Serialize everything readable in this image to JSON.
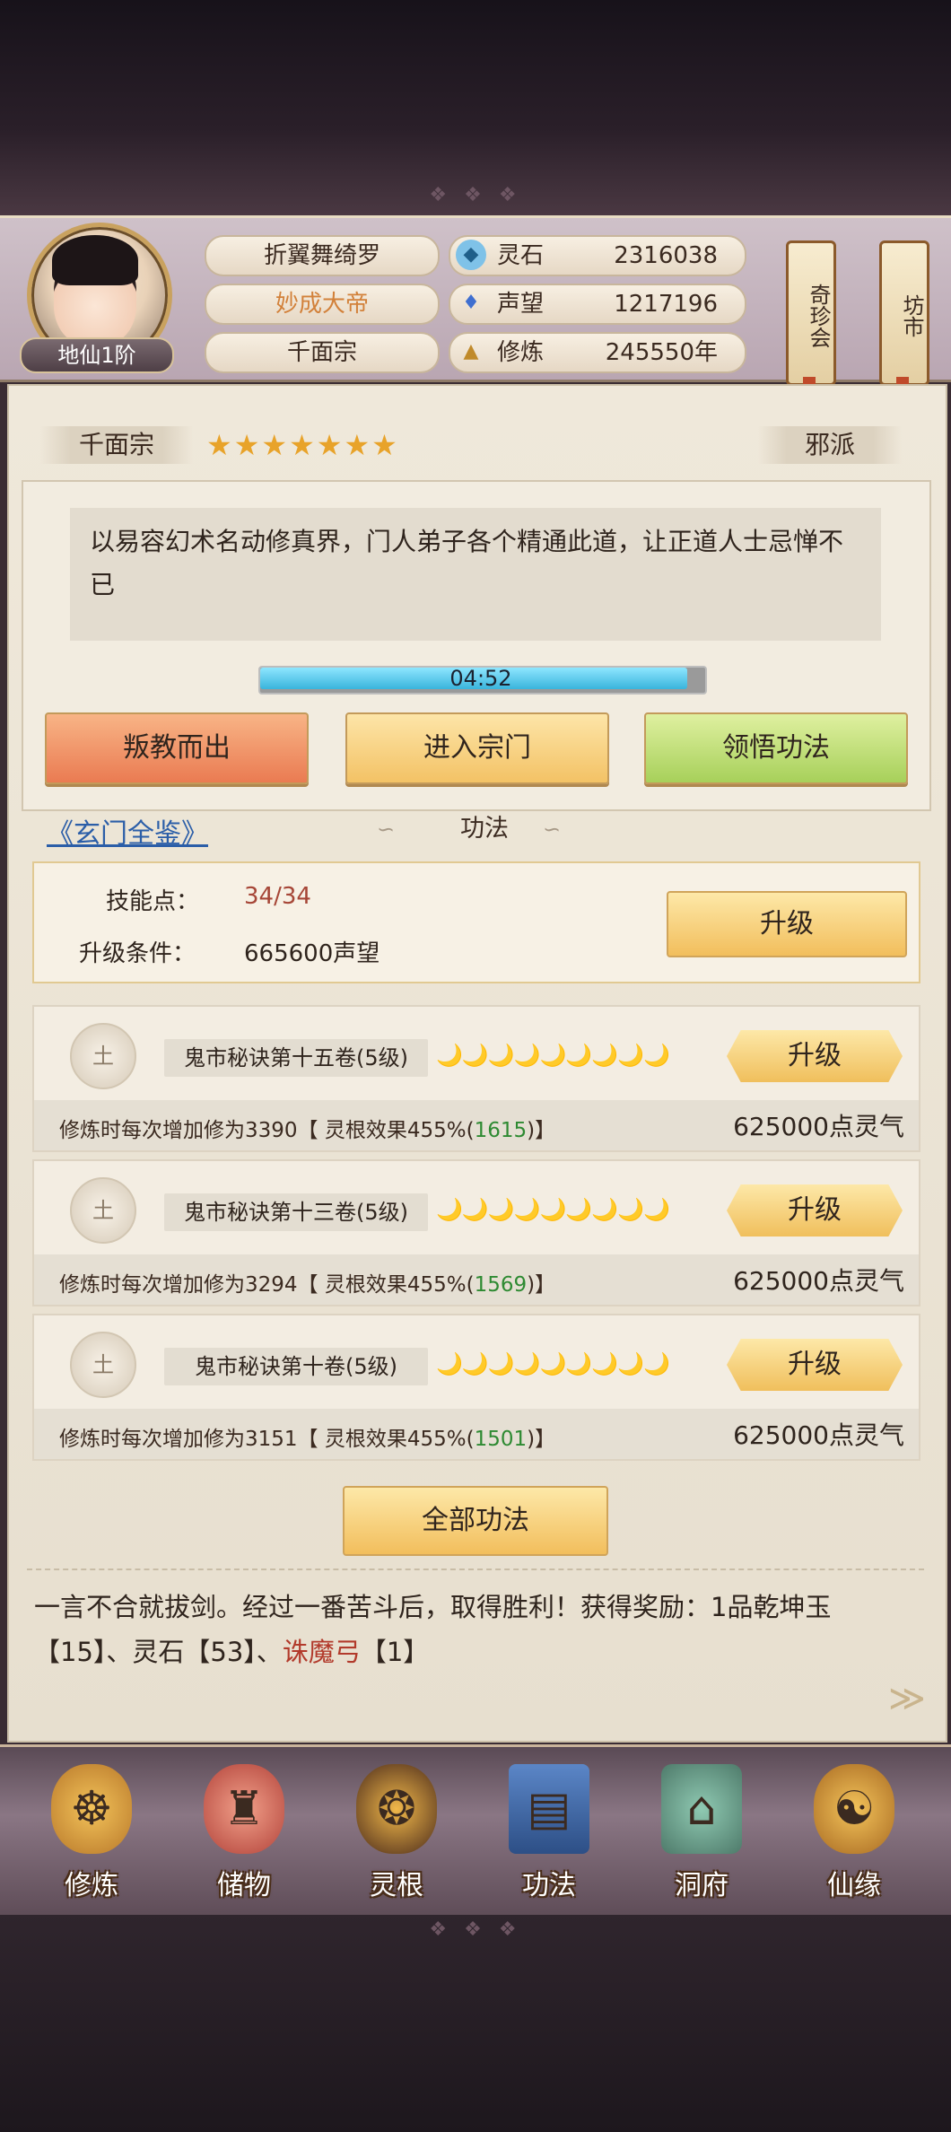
{
  "header": {
    "rank": "地仙1阶",
    "player_name": "折翼舞绮罗",
    "title": "妙成大帝",
    "sect": "千面宗",
    "stats": [
      {
        "icon": "spirit-stone-icon",
        "label": "灵石",
        "value": "2316038"
      },
      {
        "icon": "reputation-icon",
        "label": "声望",
        "value": "1217196"
      },
      {
        "icon": "meditation-icon",
        "label": "修炼",
        "value": "245550年"
      }
    ],
    "side_buttons": {
      "treasure": "奇珍会",
      "market": "坊市"
    }
  },
  "sect_panel": {
    "name": "千面宗",
    "stars": "★★★★★★★",
    "alignment": "邪派",
    "description": "以易容幻术名动修真界，门人弟子各个精通此道，让正道人士忌惮不已",
    "timer": "04:52",
    "timer_progress": 0.96,
    "buttons": {
      "defect": "叛教而出",
      "enter": "进入宗门",
      "learn": "领悟功法"
    }
  },
  "skills_section": {
    "book_link": "《玄门全鉴》",
    "title": "功法",
    "skill_points_label": "技能点：",
    "skill_points_value": "34/34",
    "condition_label": "升级条件：",
    "condition_value": "665600声望",
    "upgrade_label": "升级",
    "items": [
      {
        "element": "土",
        "name": "鬼市秘诀第十五卷(5级)",
        "moons": "🌙🌙🌙🌙🌙🌙🌙🌙🌙",
        "upgrade": "升级",
        "effect_prefix": "修炼时每次增加修为3390【 灵根效果455%(",
        "effect_green": "1615",
        "effect_suffix": ")】",
        "cost": "625000点灵气"
      },
      {
        "element": "土",
        "name": "鬼市秘诀第十三卷(5级)",
        "moons": "🌙🌙🌙🌙🌙🌙🌙🌙🌙",
        "upgrade": "升级",
        "effect_prefix": "修炼时每次增加修为3294【 灵根效果455%(",
        "effect_green": "1569",
        "effect_suffix": ")】",
        "cost": "625000点灵气"
      },
      {
        "element": "土",
        "name": "鬼市秘诀第十卷(5级)",
        "moons": "🌙🌙🌙🌙🌙🌙🌙🌙🌙",
        "upgrade": "升级",
        "effect_prefix": "修炼时每次增加修为3151【 灵根效果455%(",
        "effect_green": "1501",
        "effect_suffix": ")】",
        "cost": "625000点灵气"
      }
    ],
    "all_skills_button": "全部功法"
  },
  "log": {
    "text_1": "一言不合就拔剑。经过一番苦斗后，取得胜利！获得奖励：1品乾坤玉【15】、灵石【53】、",
    "red_item": "诛魔弓",
    "text_2": "【1】"
  },
  "nav": [
    {
      "label": "修炼",
      "icon": "cultivate-icon"
    },
    {
      "label": "储物",
      "icon": "storage-bag-icon"
    },
    {
      "label": "灵根",
      "icon": "spirit-root-icon"
    },
    {
      "label": "功法",
      "icon": "skill-book-icon"
    },
    {
      "label": "洞府",
      "icon": "cave-dwelling-icon"
    },
    {
      "label": "仙缘",
      "icon": "fortune-gourd-icon"
    }
  ],
  "colors": {
    "accent_gold": "#f2be5c",
    "link_blue": "#2b5ea8",
    "red_text": "#b23a2b",
    "green_text": "#2e8a32"
  }
}
